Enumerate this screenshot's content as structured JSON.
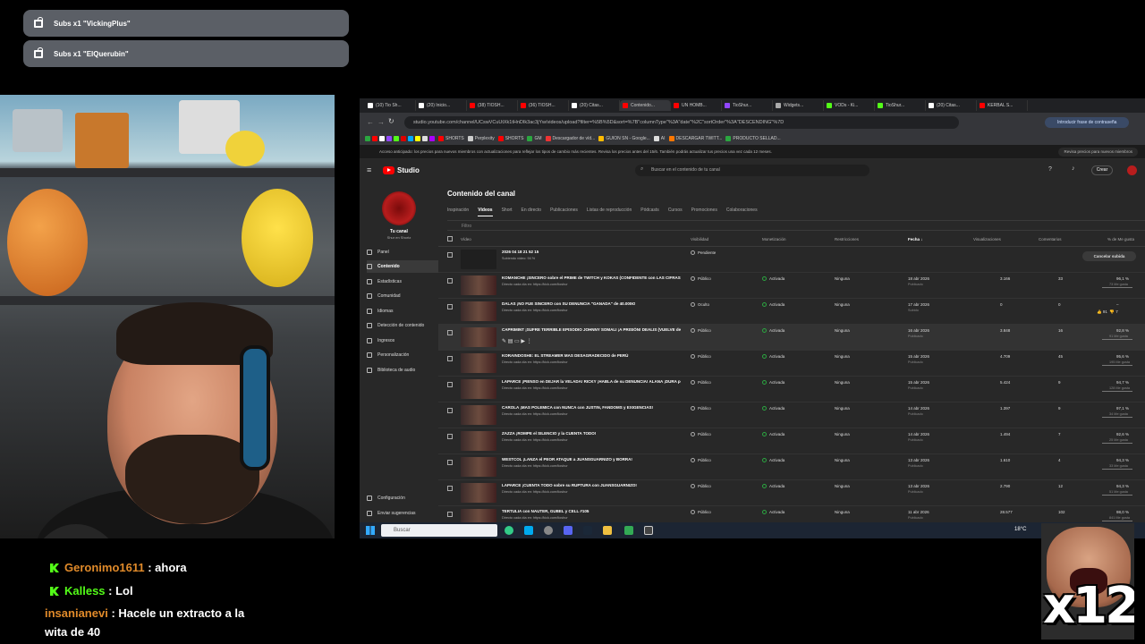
{
  "alerts": [
    {
      "text_prefix": "Subs x1 ",
      "name": "\"VickingPlus\""
    },
    {
      "text_prefix": "Subs x1 ",
      "name": "\"ElQuerubin\""
    }
  ],
  "chat": [
    {
      "user": "Geronimo1611",
      "message": ": ahora",
      "user_color": "#e08a2a",
      "badge": true
    },
    {
      "user": "Kalless",
      "message": ": Lol",
      "user_color": "#53fc18",
      "badge": true
    },
    {
      "user": "insanianevi",
      "message": ": Hacele un extracto a la",
      "message2": "wita de 40",
      "user_color": "#e08a2a",
      "badge": false
    }
  ],
  "browser": {
    "tabs": [
      "(10) Tio Sh...",
      "(20) Inicio...",
      "(38) TIOSH...",
      "(36) TIOSH...",
      "(20) Citas...",
      "Contenido...",
      "UN HOMB...",
      "TioShur...",
      "Widgets...",
      "VODs - Ki...",
      "TioShur...",
      "(20) Citas...",
      "KERBAL S..."
    ],
    "url": "studio.youtube.com/channel/UCswVCuUtXk1tHnDIk3ac3jYw/videos/upload?filter=%5B%5D&sort=%7B\"columnType\"%3A\"date\"%2C\"sortOrder\"%3A\"DESCENDING\"%7D",
    "password_button": "Introducir frase de contraseña",
    "bookmarks": [
      "SHORTS",
      "Perplexity",
      "SHORTS",
      "GM",
      "Descargador de víd...",
      "GUION SN - Google...",
      "AI",
      "DESCARGAR TWITT...",
      "PRODUCTO SELLAD..."
    ],
    "banner": "Acceso anticipado: los precios para nuevos miembros con actualizaciones para reflejar los tipos de cambio más recientes. Revisa los precios antes del 15/6. También podrás actualizar tus precios una vez cada 12 meses.",
    "banner_button": "Revisa precios para nuevos miembros"
  },
  "studio": {
    "logo": "Studio",
    "search_placeholder": "Buscar en el contenido de tu canal",
    "create": "Crear",
    "channel_label": "Tu canal",
    "channel_name": "Shur en Shortz",
    "nav": [
      "Panel",
      "Contenido",
      "Estadísticas",
      "Comunidad",
      "Idiomas",
      "Detección de contenido",
      "Ingresos",
      "Personalización",
      "Biblioteca de audio"
    ],
    "nav_bottom": [
      "Configuración",
      "Enviar sugerencias"
    ],
    "title": "Contenido del canal",
    "tabs": [
      "Inspiración",
      "Vídeos",
      "Short",
      "En directo",
      "Publicaciones",
      "Listas de reproducción",
      "Pódcasts",
      "Cursos",
      "Promociones",
      "Colaboraciones"
    ],
    "filter_placeholder": "Filtro",
    "columns": [
      "Vídeo",
      "Visibilidad",
      "Monetización",
      "Restricciones",
      "Fecha ↓",
      "Visualizaciones",
      "Comentarios",
      "% de Me gusta"
    ],
    "pending": {
      "title": "2026 04 18 21 52 15",
      "status": "Subiendo vídeo: 94 %",
      "visibility": "Pendiente",
      "button": "Cancelar subida"
    },
    "rows": [
      {
        "title": "KOMANCHE ¡SINCERO sobre el PRIME de TWITCH y KOKAS (CONFIDENTE con LAS CIFRAS de A...",
        "desc": "Directo cada día en: https://kick.com/tioshur",
        "vis": "Público",
        "mon": "Activada",
        "res": "Ninguna",
        "date": "18 abr 2026",
        "state": "Publicado",
        "views": "3.166",
        "comments": "33",
        "likes": "96,1 %",
        "likes_sub": "73 Me gusta"
      },
      {
        "title": "DALAS ¡NO FUE SINCERO con SU DENUNCIA \"GANADA\" de 40.000€!",
        "desc": "Directo cada día en: https://kick.com/tioshur",
        "vis": "Oculto",
        "mon": "Activada",
        "res": "Ninguna",
        "date": "17 abr 2026",
        "state": "Subido",
        "views": "0",
        "comments": "0",
        "likes": "–",
        "likes_sub": ""
      },
      {
        "title": "CAPRIMINT ¡SUFRE TERRIBLE EPISODIO JOHNNY SOMALI ¡A PRISIÓN! DEALIS (VUELVE despu...",
        "desc": "",
        "vis": "Público",
        "mon": "Activada",
        "res": "Ninguna",
        "date": "16 abr 2026",
        "state": "Publicado",
        "views": "3.848",
        "comments": "16",
        "likes": "92,8 %",
        "likes_sub": "91 Me gusta"
      },
      {
        "title": "KORAINDOSHE: EL STREAMER MAS DESAGRADECIDO de PERÚ",
        "desc": "Directo cada día en: https://kick.com/tioshur",
        "vis": "Público",
        "mon": "Activada",
        "res": "Ninguna",
        "date": "15 abr 2026",
        "state": "Publicado",
        "views": "4.709",
        "comments": "45",
        "likes": "95,6 %",
        "likes_sub": "195 Me gusta"
      },
      {
        "title": "LAPARCE ¡PIENSO en DEJAR la VELADA! RICKY ¡HABLA de su DENUNCIA! ALANA ¡DURA por SUPE...",
        "desc": "Directo cada día en: https://kick.com/tioshur",
        "vis": "Público",
        "mon": "Activada",
        "res": "Ninguna",
        "date": "15 abr 2026",
        "state": "Publicado",
        "views": "5.424",
        "comments": "9",
        "likes": "94,7 %",
        "likes_sub": "128 Me gusta"
      },
      {
        "title": "CAROLA ¡MAS POLEMICA con NUNCA con JUSTIN, FANDOMS y EXIGENCIAS!",
        "desc": "Directo cada día en: https://kick.com/tioshur",
        "vis": "Público",
        "mon": "Activada",
        "res": "Ninguna",
        "date": "14 abr 2026",
        "state": "Publicado",
        "views": "1.397",
        "comments": "9",
        "likes": "97,1 %",
        "likes_sub": "34 Me gusta"
      },
      {
        "title": "ZAZZA ¡ROMPE el SILENCIO y la CUENTA TODO!",
        "desc": "Directo cada día en: https://kick.com/tioshur",
        "vis": "Público",
        "mon": "Activada",
        "res": "Ninguna",
        "date": "14 abr 2026",
        "state": "Publicado",
        "views": "1.494",
        "comments": "7",
        "likes": "92,6 %",
        "likes_sub": "25 Me gusta"
      },
      {
        "title": "WESTCOL ¡LANZA el PEOR ATAQUE a JUANSGUARNIZO y BORRA!",
        "desc": "Directo cada día en: https://kick.com/tioshur",
        "vis": "Público",
        "mon": "Activada",
        "res": "Ninguna",
        "date": "13 abr 2026",
        "state": "Publicado",
        "views": "1.610",
        "comments": "4",
        "likes": "94,3 %",
        "likes_sub": "33 Me gusta"
      },
      {
        "title": "LAPARCE ¡CUENTA TODO sobre su RUPTURA con JUANSGUARNIZO!",
        "desc": "Directo cada día en: https://kick.com/tioshur",
        "vis": "Público",
        "mon": "Activada",
        "res": "Ninguna",
        "date": "13 abr 2026",
        "state": "Publicado",
        "views": "2.790",
        "comments": "12",
        "likes": "94,3 %",
        "likes_sub": "51 Me gusta"
      },
      {
        "title": "TERTULIA con NAUTER, GUBEL y CELL #105",
        "desc": "Directo cada día en: https://kick.com/tioshur",
        "vis": "Público",
        "mon": "Activada",
        "res": "Ninguna",
        "date": "11 abr 2026",
        "state": "Publicado",
        "views": "28.577",
        "comments": "102",
        "likes": "98,0 %",
        "likes_sub": "841 Me gusta"
      }
    ],
    "hover_likes": "91",
    "hover_dislikes": "7"
  },
  "taskbar": {
    "search": "Buscar",
    "weather": "18°C"
  },
  "emote": {
    "text": "x12"
  }
}
